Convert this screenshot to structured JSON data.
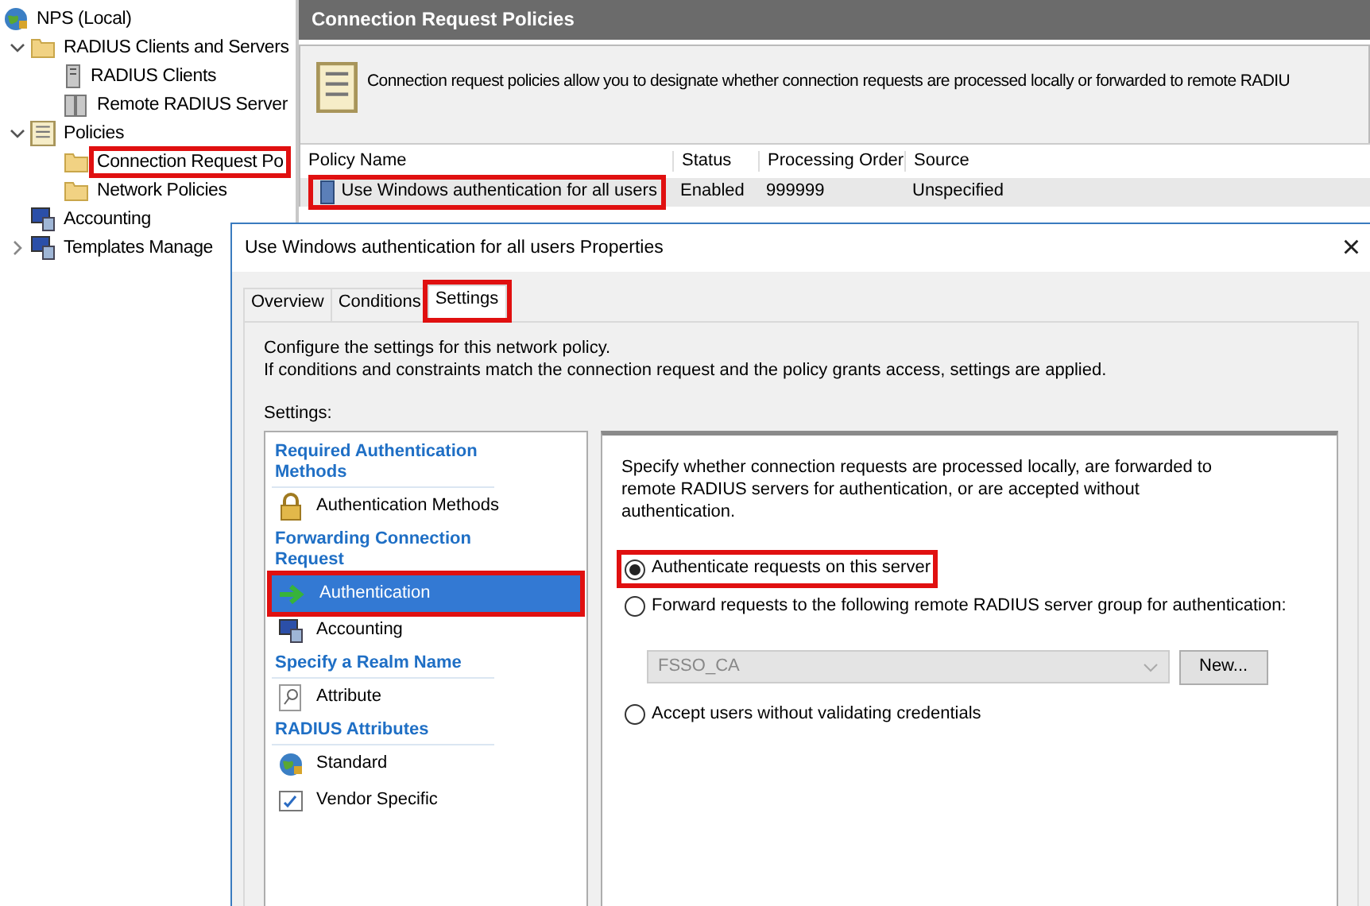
{
  "tree": {
    "label": "NPS (Local)",
    "children": [
      {
        "label": "RADIUS Clients and Servers",
        "expanded": true,
        "highlighted": false,
        "children": [
          {
            "label": "RADIUS Clients",
            "highlighted": false
          },
          {
            "label": "Remote RADIUS Server",
            "highlighted": false
          }
        ]
      },
      {
        "label": "Policies",
        "expanded": true,
        "highlighted": false,
        "children": [
          {
            "label": "Connection Request Po",
            "highlighted": true
          },
          {
            "label": "Network Policies",
            "highlighted": false
          }
        ]
      },
      {
        "label": "Accounting",
        "highlighted": false
      },
      {
        "label": "Templates Manage",
        "expanded": false,
        "highlighted": false
      }
    ]
  },
  "panel": {
    "title": "Connection Request Policies",
    "description": "Connection request policies allow you to designate whether connection requests are processed locally or forwarded to remote RADIU",
    "table": {
      "columns": [
        "Policy Name",
        "Status",
        "Processing Order",
        "Source"
      ],
      "rows": [
        {
          "cells": [
            "Use Windows authentication for all users",
            "Enabled",
            "999999",
            "Unspecified"
          ],
          "highlighted": true
        }
      ]
    }
  },
  "dialog": {
    "title": "Use Windows authentication for all users Properties",
    "close": "×",
    "tabs": [
      {
        "label": "Overview",
        "selected": false,
        "highlighted": false
      },
      {
        "label": "Conditions",
        "selected": false,
        "highlighted": false
      },
      {
        "label": "Settings",
        "selected": true,
        "highlighted": true
      }
    ],
    "intro": [
      "Configure the settings for this network policy.",
      "If conditions and constraints match the connection request and the policy grants access, settings are applied."
    ],
    "settings_label": "Settings:",
    "sidebar": [
      {
        "kind": "header",
        "label": "Required Authentication Methods"
      },
      {
        "kind": "item",
        "label": "Authentication Methods",
        "selected": false,
        "highlighted": false
      },
      {
        "kind": "header",
        "label": "Forwarding Connection Request"
      },
      {
        "kind": "item",
        "label": "Authentication",
        "selected": true,
        "highlighted": true
      },
      {
        "kind": "item",
        "label": "Accounting",
        "selected": false,
        "highlighted": false
      },
      {
        "kind": "header",
        "label": "Specify a Realm Name"
      },
      {
        "kind": "item",
        "label": "Attribute",
        "selected": false,
        "highlighted": false
      },
      {
        "kind": "header",
        "label": "RADIUS Attributes"
      },
      {
        "kind": "item",
        "label": "Standard",
        "selected": false,
        "highlighted": false
      },
      {
        "kind": "item",
        "label": "Vendor Specific",
        "selected": false,
        "highlighted": false
      }
    ],
    "content": {
      "description": "Specify whether connection requests are processed locally, are forwarded to remote RADIUS servers for authentication, or are accepted without authentication.",
      "options": [
        {
          "label": "Authenticate requests on this server",
          "selected": true,
          "highlighted": true
        },
        {
          "label": "Forward requests to the following remote RADIUS server group for authentication:",
          "selected": false,
          "highlighted": false
        },
        {
          "label": "Accept users without validating credentials",
          "selected": false,
          "highlighted": false
        }
      ],
      "server_group": {
        "value": "FSSO_CA",
        "disabled": true
      },
      "new_button": "New..."
    }
  }
}
